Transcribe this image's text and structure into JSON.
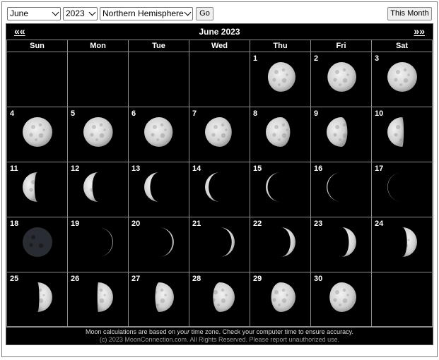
{
  "controls": {
    "month_select": "June",
    "year_select": "2023",
    "hemisphere_select": "Northern Hemisphere",
    "go_label": "Go",
    "this_month_label": "This Month"
  },
  "calendar": {
    "title": "June 2023",
    "prev_label": "««",
    "next_label": "»»",
    "weekdays": [
      "Sun",
      "Mon",
      "Tue",
      "Wed",
      "Thu",
      "Fri",
      "Sat"
    ],
    "lead_blanks": 4,
    "days": [
      {
        "day": "1",
        "illumination": 0.93,
        "waxing": true
      },
      {
        "day": "2",
        "illumination": 0.97,
        "waxing": true
      },
      {
        "day": "3",
        "illumination": 1.0,
        "waxing": true
      },
      {
        "day": "4",
        "illumination": 1.0,
        "waxing": false
      },
      {
        "day": "5",
        "illumination": 0.99,
        "waxing": false
      },
      {
        "day": "6",
        "illumination": 0.96,
        "waxing": false
      },
      {
        "day": "7",
        "illumination": 0.9,
        "waxing": false
      },
      {
        "day": "8",
        "illumination": 0.82,
        "waxing": false
      },
      {
        "day": "9",
        "illumination": 0.7,
        "waxing": false
      },
      {
        "day": "10",
        "illumination": 0.55,
        "waxing": false
      },
      {
        "day": "11",
        "illumination": 0.4,
        "waxing": false
      },
      {
        "day": "12",
        "illumination": 0.3,
        "waxing": false
      },
      {
        "day": "13",
        "illumination": 0.2,
        "waxing": false
      },
      {
        "day": "14",
        "illumination": 0.12,
        "waxing": false
      },
      {
        "day": "15",
        "illumination": 0.06,
        "waxing": false
      },
      {
        "day": "16",
        "illumination": 0.03,
        "waxing": false
      },
      {
        "day": "17",
        "illumination": 0.01,
        "waxing": false
      },
      {
        "day": "18",
        "illumination": 0.0,
        "waxing": true
      },
      {
        "day": "19",
        "illumination": 0.02,
        "waxing": true
      },
      {
        "day": "20",
        "illumination": 0.05,
        "waxing": true
      },
      {
        "day": "21",
        "illumination": 0.1,
        "waxing": true
      },
      {
        "day": "22",
        "illumination": 0.17,
        "waxing": true
      },
      {
        "day": "23",
        "illumination": 0.25,
        "waxing": true
      },
      {
        "day": "24",
        "illumination": 0.34,
        "waxing": true
      },
      {
        "day": "25",
        "illumination": 0.44,
        "waxing": true
      },
      {
        "day": "26",
        "illumination": 0.53,
        "waxing": true
      },
      {
        "day": "27",
        "illumination": 0.63,
        "waxing": true
      },
      {
        "day": "28",
        "illumination": 0.73,
        "waxing": true
      },
      {
        "day": "29",
        "illumination": 0.82,
        "waxing": true
      },
      {
        "day": "30",
        "illumination": 0.9,
        "waxing": true
      }
    ],
    "footer_line1_before": "Moon calculations are based on ",
    "footer_line1_em": "your",
    "footer_line1_after": " time zone. Check your computer time to ensure accuracy.",
    "footer_line2": "(c) 2023 MoonConnection.com. All Rights Reserved. Please report unauthorized use."
  },
  "colors": {
    "calendar_bg": "#000000",
    "grid_line": "#8c8c8c",
    "moon_light": "#e8e8e8",
    "moon_shadow": "#111111"
  }
}
